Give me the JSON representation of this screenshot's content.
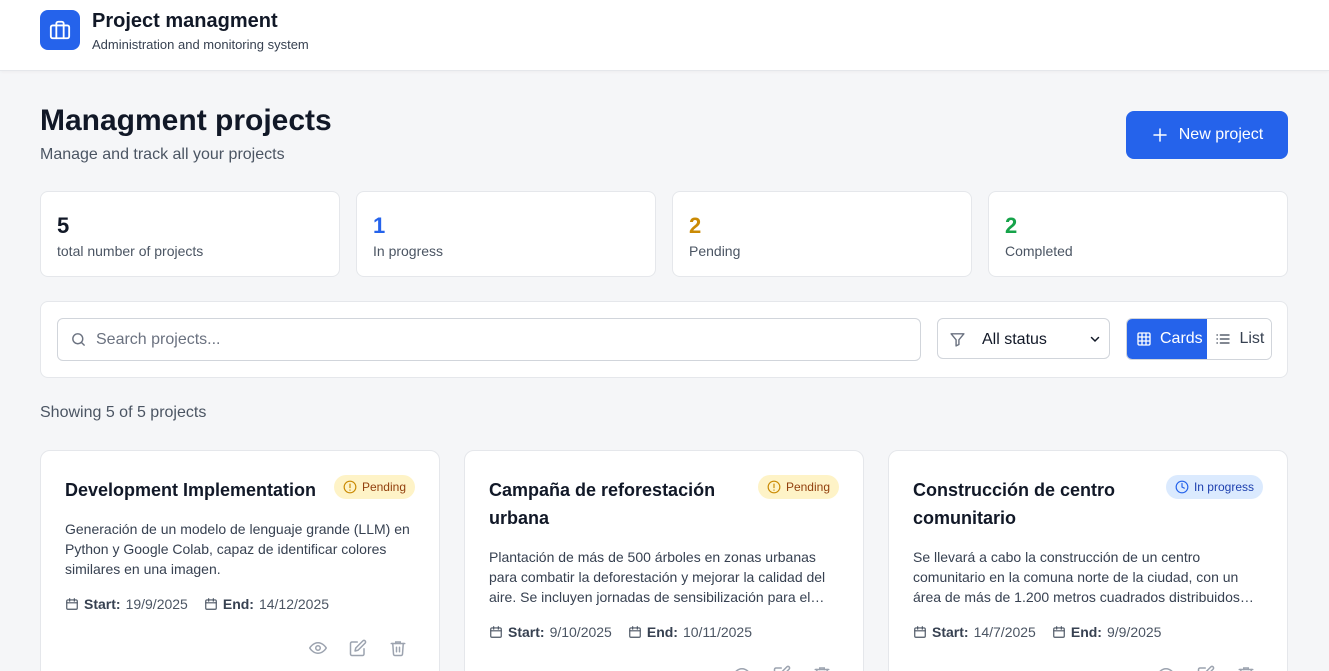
{
  "header": {
    "logo_icon": "briefcase-icon",
    "title": "Project managment",
    "subtitle": "Administration and monitoring system"
  },
  "page": {
    "title": "Managment projects",
    "subtitle": "Manage and track all your projects",
    "new_button_label": "New project"
  },
  "stats": [
    {
      "value": "5",
      "label": "total number of projects",
      "color": "#111827"
    },
    {
      "value": "1",
      "label": "In progress",
      "color": "#2563eb"
    },
    {
      "value": "2",
      "label": "Pending",
      "color": "#ca8a04"
    },
    {
      "value": "2",
      "label": "Completed",
      "color": "#16a34a"
    }
  ],
  "toolbar": {
    "search_placeholder": "Search projects...",
    "search_value": "",
    "status_selected": "All status",
    "view_cards_label": "Cards",
    "view_list_label": "List",
    "active_view": "Cards"
  },
  "showing_text": "Showing 5 of 5 projects",
  "projects": [
    {
      "title": "Development Implementation",
      "status": "Pending",
      "description": "Generación de un modelo de lenguaje grande (LLM) en Python y Google Colab, capaz de identificar colores similares en una imagen.",
      "start_label": "Start:",
      "start": "19/9/2025",
      "end_label": "End:",
      "end": "14/12/2025"
    },
    {
      "title": "Campaña de reforestación urbana",
      "status": "Pending",
      "description": "Plantación de más de 500 árboles en zonas urbanas para combatir la deforestación y mejorar la calidad del aire. Se incluyen jornadas de sensibilización para el cuidado…",
      "start_label": "Start:",
      "start": "9/10/2025",
      "end_label": "End:",
      "end": "10/11/2025"
    },
    {
      "title": "Construcción de centro comunitario",
      "status": "In progress",
      "description": "Se llevará a cabo la construcción de un centro comunitario en la comuna norte de la ciudad, con un área de más de 1.200 metros cuadrados distribuidos e…",
      "start_label": "Start:",
      "start": "14/7/2025",
      "end_label": "End:",
      "end": "9/9/2025"
    }
  ],
  "colors": {
    "accent": "#2563eb",
    "pending_bg": "#fef3c7",
    "progress_bg": "#dbeafe"
  }
}
